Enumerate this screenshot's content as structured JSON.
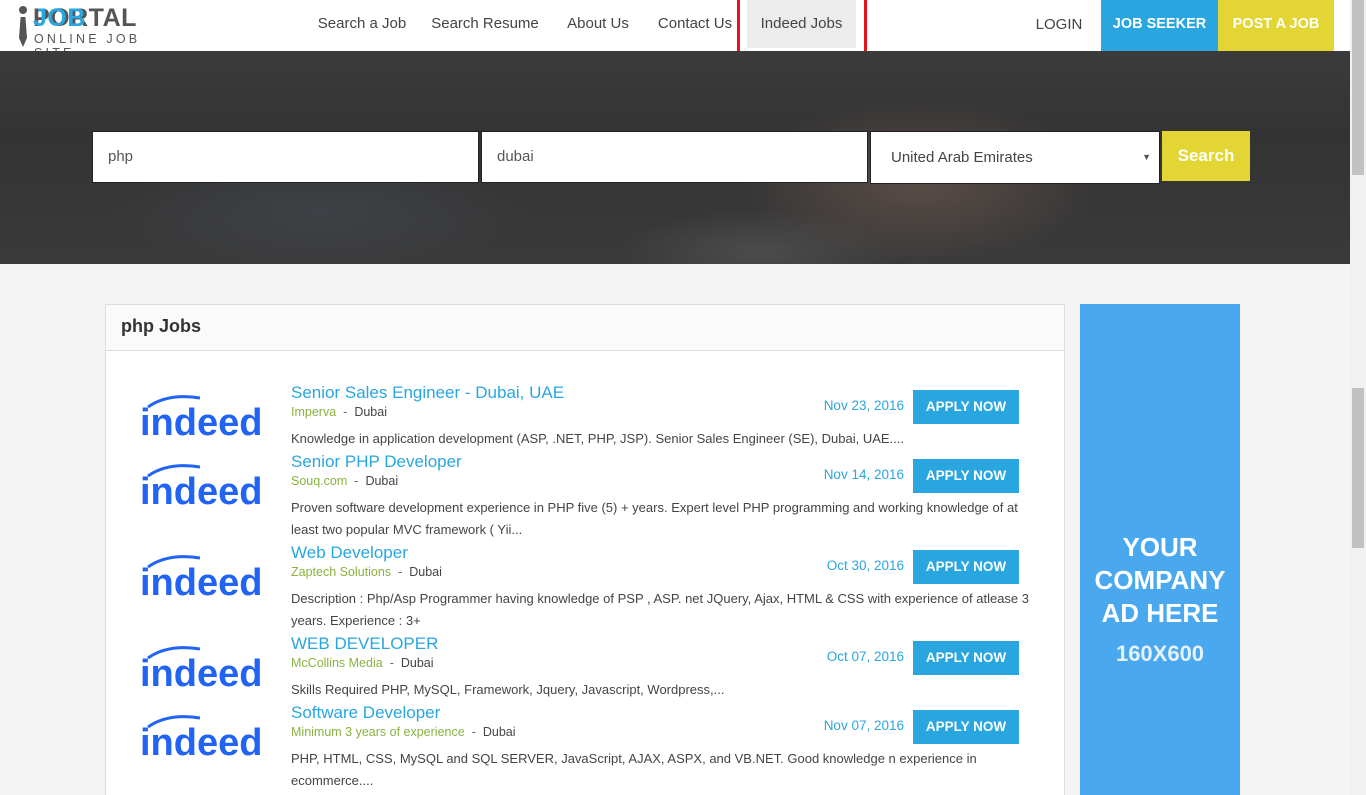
{
  "logo": {
    "job": "JOB",
    "portal": "PORTAL",
    "tagline": "ONLINE JOB SITE"
  },
  "nav": {
    "items": [
      {
        "label": "Search a Job"
      },
      {
        "label": "Search Resume"
      },
      {
        "label": "About Us"
      },
      {
        "label": "Contact Us"
      },
      {
        "label": "Indeed Jobs",
        "active": true
      }
    ],
    "login": "LOGIN",
    "job_seeker": "JOB SEEKER",
    "post_job": "POST A JOB"
  },
  "search": {
    "keyword": "php",
    "location": "dubai",
    "country": "United Arab Emirates",
    "button": "Search"
  },
  "panel": {
    "title": "php Jobs"
  },
  "jobs": [
    {
      "title": "Senior Sales Engineer - Dubai, UAE",
      "company": "Imperva",
      "city": "Dubai",
      "date": "Nov 23, 2016",
      "apply": "APPLY NOW",
      "desc": "Knowledge in application development (ASP, .NET, PHP, JSP). Senior Sales Engineer (SE), Dubai, UAE...."
    },
    {
      "title": "Senior PHP Developer",
      "company": "Souq.com",
      "city": "Dubai",
      "date": "Nov 14, 2016",
      "apply": "APPLY NOW",
      "desc": "Proven software development experience in PHP five (5) + years. Expert level PHP programming and working knowledge of at least two popular MVC framework ( Yii..."
    },
    {
      "title": "Web Developer",
      "company": "Zaptech Solutions",
      "city": "Dubai",
      "date": "Oct 30, 2016",
      "apply": "APPLY NOW",
      "desc": "Description : Php/Asp Programmer having knowledge of PSP , ASP. net JQuery, Ajax, HTML & CSS with experience of atlease 3 years. Experience : 3+"
    },
    {
      "title": "WEB DEVELOPER",
      "company": "McCollins Media",
      "city": "Dubai",
      "date": "Oct 07, 2016",
      "apply": "APPLY NOW",
      "desc": "Skills Required PHP, MySQL, Framework, Jquery, Javascript, Wordpress,..."
    },
    {
      "title": "Software Developer",
      "company": "Minimum 3 years of experience",
      "city": "Dubai",
      "date": "Nov 07, 2016",
      "apply": "APPLY NOW",
      "desc": "PHP, HTML, CSS, MySQL and SQL SERVER, JavaScript, AJAX, ASPX, and VB.NET. Good knowledge n experience in ecommerce...."
    }
  ],
  "indeed_logo_text": "indeed",
  "ad": {
    "line1": "YOUR",
    "line2": "COMPANY",
    "line3": "AD HERE",
    "size": "160X600"
  },
  "colors": {
    "accent_blue": "#29a6e0",
    "accent_yellow": "#e3d533",
    "company_green": "#8ab23f",
    "highlight_red": "#e2131b",
    "ad_blue": "#4aa8ef"
  }
}
